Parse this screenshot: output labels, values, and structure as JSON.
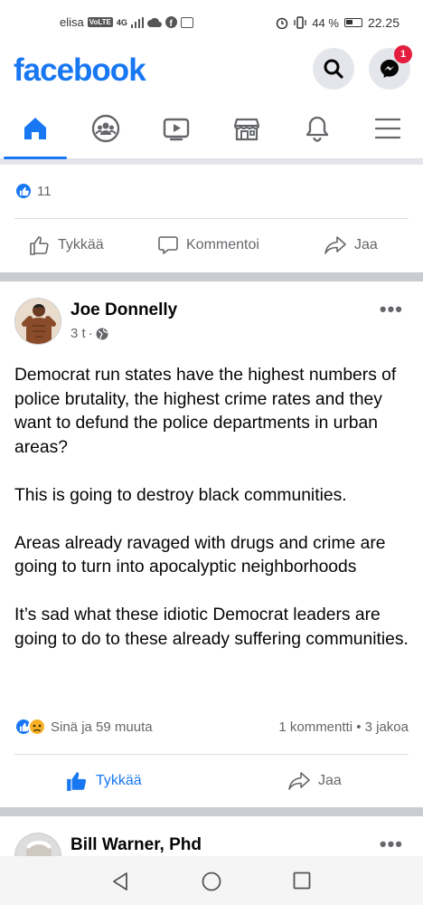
{
  "status_bar": {
    "carrier": "elisa",
    "volte": "VoLTE",
    "network": "4G",
    "battery": "44 %",
    "time": "22.25"
  },
  "header": {
    "logo": "facebook",
    "messenger_badge": "1",
    "brand_color": "#1877f2"
  },
  "tabs": [
    {
      "name": "home",
      "icon": "home-icon",
      "active": true
    },
    {
      "name": "groups",
      "icon": "groups-icon"
    },
    {
      "name": "watch",
      "icon": "video-icon"
    },
    {
      "name": "marketplace",
      "icon": "store-icon"
    },
    {
      "name": "notifications",
      "icon": "bell-icon"
    },
    {
      "name": "menu",
      "icon": "hamburger-icon"
    }
  ],
  "prev_post": {
    "reaction_count": "11",
    "actions": {
      "like": "Tykkää",
      "comment": "Kommentoi",
      "share": "Jaa"
    }
  },
  "post": {
    "author": "Joe Donnelly",
    "time": "3 t",
    "paragraphs": [
      "Democrat run states have the highest numbers of police brutality, the highest crime rates and they want to defund the police departments in urban areas?",
      "This is going to destroy black communities.",
      "Areas already ravaged with drugs and crime are going to turn into apocalyptic neighborhoods",
      "It’s sad what these idiotic Democrat leaders are going to do to these already suffering communities."
    ],
    "reactions_text": "Sinä ja 59 muuta",
    "stats_text": "1 kommentti • 3 jakoa",
    "actions": {
      "like": "Tykkää",
      "share": "Jaa"
    }
  },
  "next_post": {
    "author": "Bill Warner, Phd"
  }
}
